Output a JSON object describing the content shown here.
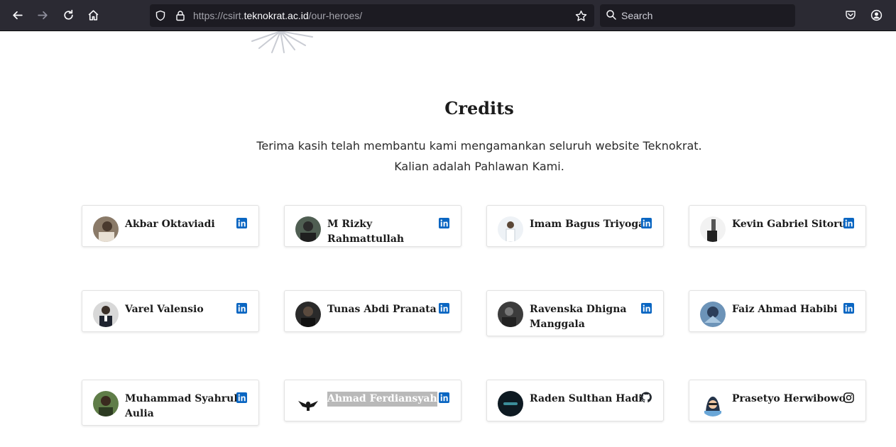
{
  "browser": {
    "url_prefix": "https://csirt.",
    "url_host": "teknokrat.ac.id",
    "url_path": "/our-heroes/",
    "search_placeholder": "Search"
  },
  "page": {
    "title": "Credits",
    "subtitle_line1": "Terima kasih telah membantu kami mengamankan seluruh website Teknokrat.",
    "subtitle_line2": "Kalian adalah Pahlawan Kami."
  },
  "heroes": [
    {
      "name": "Akbar Oktaviadi",
      "social": "linkedin-icon",
      "avatar_color": "#7a6a5a"
    },
    {
      "name": "M Rizky Rahmattullah",
      "social": "linkedin-icon",
      "avatar_color": "#3d4a3f"
    },
    {
      "name": "Imam Bagus Triyoga",
      "social": "linkedin-icon",
      "avatar_color": "#dfe6ee"
    },
    {
      "name": "Kevin Gabriel Sitorus",
      "social": "linkedin-icon",
      "avatar_color": "#4a4a4a"
    },
    {
      "name": "Varel Valensio",
      "social": "linkedin-icon",
      "avatar_color": "#cfcfcf"
    },
    {
      "name": "Tunas Abdi Pranata",
      "social": "linkedin-icon",
      "avatar_color": "#2a2a2a"
    },
    {
      "name": "Ravenska Dhigna Manggala",
      "social": "linkedin-icon",
      "avatar_color": "#3a3a3a"
    },
    {
      "name": "Faiz Ahmad Habibi",
      "social": "linkedin-icon",
      "avatar_color": "#3f6fa0"
    },
    {
      "name": "Muhammad Syahrul Aulia",
      "social": "linkedin-icon",
      "avatar_color": "#4c6b3b"
    },
    {
      "name": "Ahmad Ferdiansyah",
      "social": "linkedin-icon",
      "avatar_color": "#ffffff"
    },
    {
      "name": "Raden Sulthan Hadi",
      "social": "github-icon",
      "avatar_color": "#0e1a22"
    },
    {
      "name": "Prasetyo Herwibowo",
      "social": "instagram-icon",
      "avatar_color": "#ffffff"
    }
  ],
  "colors": {
    "linkedin": "#0a66c2",
    "toolbar_bg": "#2b2a33",
    "urlbar_bg": "#1c1b22"
  }
}
